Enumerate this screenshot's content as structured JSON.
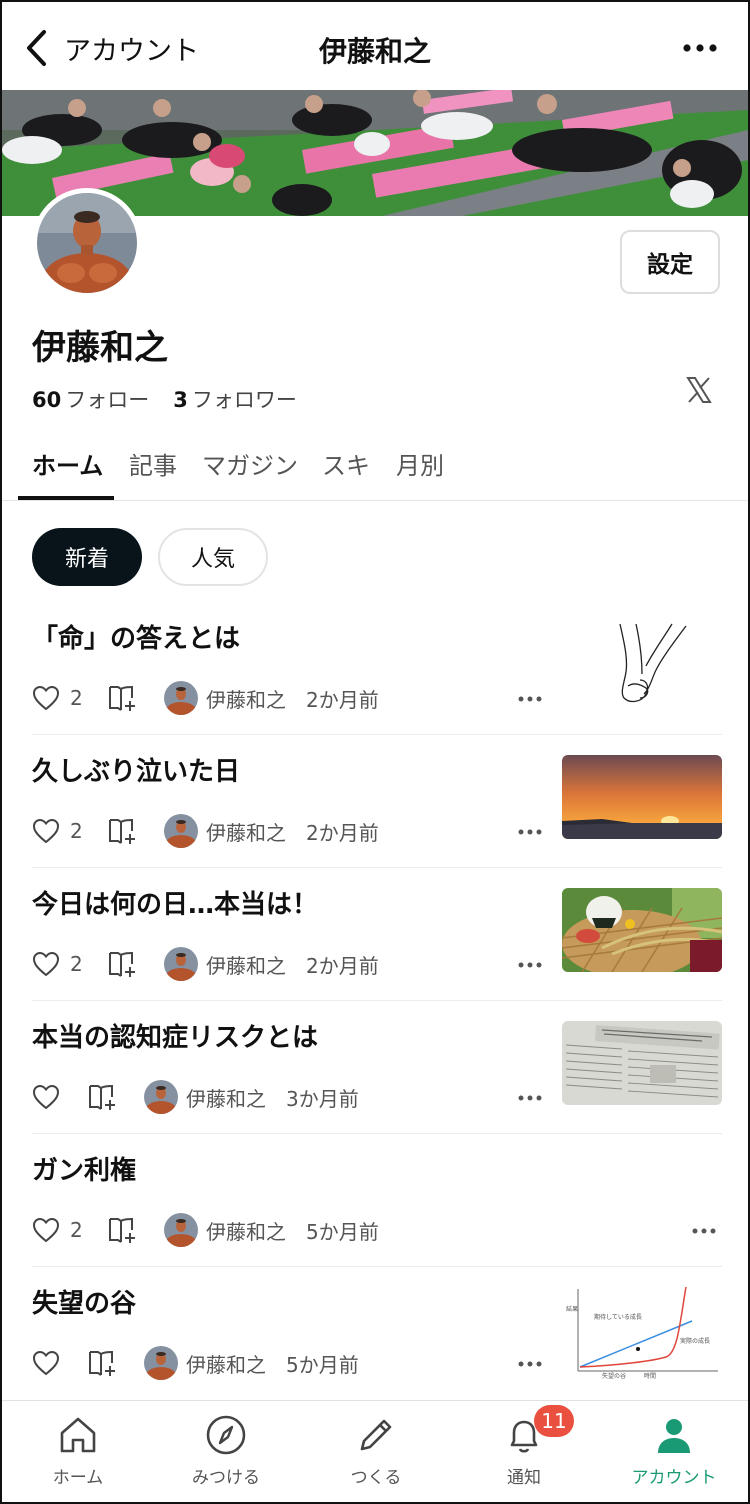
{
  "header": {
    "back_label": "アカウント",
    "title": "伊藤和之"
  },
  "profile": {
    "name": "伊藤和之",
    "settings_label": "設定",
    "follow_count": "60",
    "follow_label": "フォロー",
    "follower_count": "3",
    "follower_label": "フォロワー"
  },
  "tabs": [
    {
      "label": "ホーム",
      "active": true
    },
    {
      "label": "記事"
    },
    {
      "label": "マガジン"
    },
    {
      "label": "スキ"
    },
    {
      "label": "月別"
    }
  ],
  "filters": {
    "new": "新着",
    "popular": "人気"
  },
  "articles": [
    {
      "title": "「命」の答えとは",
      "likes": "2",
      "author": "伊藤和之",
      "time": "2か月前",
      "thumb": "holding-hands-line-drawing"
    },
    {
      "title": "久しぶり泣いた日",
      "likes": "2",
      "author": "伊藤和之",
      "time": "2か月前",
      "thumb": "sunset-photo"
    },
    {
      "title": "今日は何の日…本当は！",
      "likes": "2",
      "author": "伊藤和之",
      "time": "2か月前",
      "thumb": "rice-onigiri-photo"
    },
    {
      "title": "本当の認知症リスクとは",
      "likes": "",
      "author": "伊藤和之",
      "time": "3か月前",
      "thumb": "newspaper-photo"
    },
    {
      "title": "ガン利権",
      "likes": "2",
      "author": "伊藤和之",
      "time": "5か月前",
      "thumb": ""
    },
    {
      "title": "失望の谷",
      "likes": "",
      "author": "伊藤和之",
      "time": "5か月前",
      "thumb": "growth-chart-diagram"
    }
  ],
  "chart_thumb": {
    "ylabel": "結果",
    "expected_label": "期待している成長",
    "actual_label": "実際の成長",
    "valley_label": "失望の谷",
    "xlabel": "時間"
  },
  "nav": [
    {
      "label": "ホーム",
      "icon": "home-icon"
    },
    {
      "label": "みつける",
      "icon": "compass-icon"
    },
    {
      "label": "つくる",
      "icon": "pencil-icon"
    },
    {
      "label": "通知",
      "icon": "bell-icon",
      "badge": "11"
    },
    {
      "label": "アカウント",
      "icon": "person-icon",
      "active": true
    }
  ],
  "colors": {
    "accent": "#1a9a74",
    "badge": "#e9503f",
    "pill_active": "#08131a"
  }
}
